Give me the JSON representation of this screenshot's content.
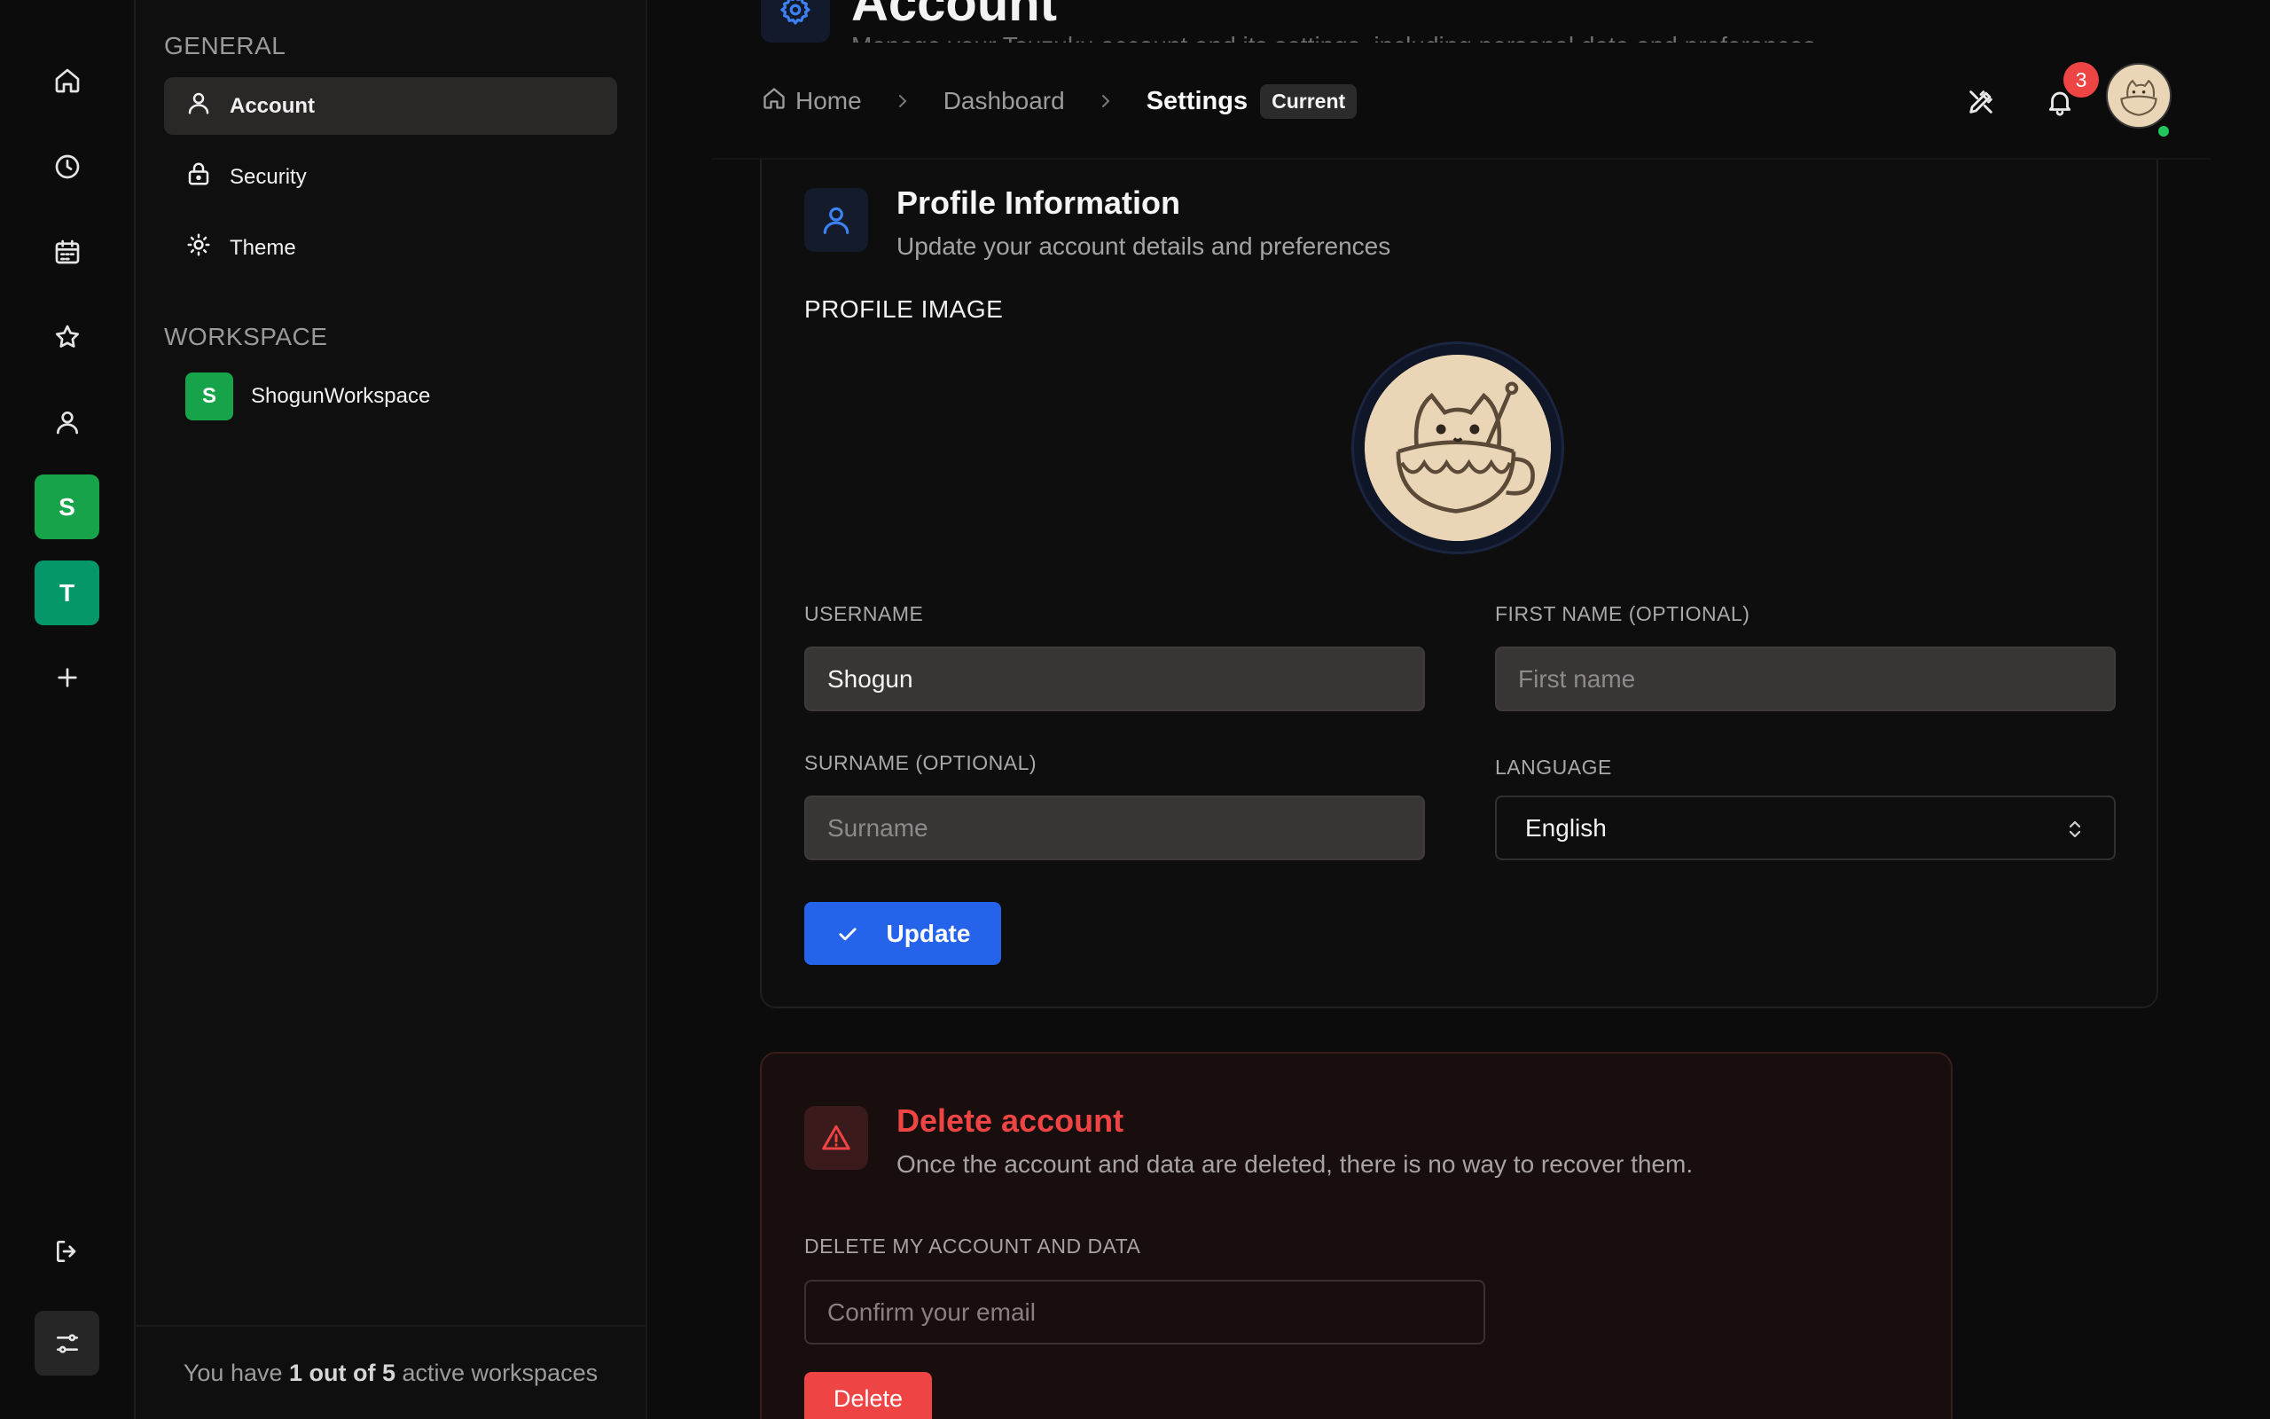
{
  "page": {
    "title": "Account",
    "subtitle": "Manage your Tsuzuku account and its settings, including personal data and preferences."
  },
  "rail": {
    "workspaces": [
      {
        "initial": "S",
        "color": "#16a34a"
      },
      {
        "initial": "T",
        "color": "#059669"
      }
    ]
  },
  "sidebar": {
    "general_label": "GENERAL",
    "items": [
      {
        "label": "Account",
        "icon": "user-icon",
        "active": true
      },
      {
        "label": "Security",
        "icon": "lock-icon",
        "active": false
      },
      {
        "label": "Theme",
        "icon": "sun-icon",
        "active": false
      }
    ],
    "workspace_label": "WORKSPACE",
    "workspace": {
      "initial": "S",
      "name": "ShogunWorkspace"
    },
    "footer": {
      "prefix": "You have ",
      "count": "1 out of 5",
      "suffix": " active workspaces"
    }
  },
  "breadcrumb": {
    "home": "Home",
    "dashboard": "Dashboard",
    "current": "Settings",
    "badge": "Current"
  },
  "header": {
    "notification_count": "3"
  },
  "profile": {
    "title": "Profile Information",
    "subtitle": "Update your account details and preferences",
    "image_label": "PROFILE IMAGE",
    "username_label": "USERNAME",
    "username_value": "Shogun",
    "firstname_label": "FIRST NAME (OPTIONAL)",
    "firstname_placeholder": "First name",
    "surname_label": "SURNAME (OPTIONAL)",
    "surname_placeholder": "Surname",
    "language_label": "LANGUAGE",
    "language_value": "English",
    "update_label": "Update"
  },
  "danger": {
    "title": "Delete account",
    "subtitle": "Once the account and data are deleted, there is no way to recover them.",
    "field_label": "DELETE MY ACCOUNT AND DATA",
    "placeholder": "Confirm your email",
    "button_label": "Delete"
  },
  "colors": {
    "accent": "#2563eb",
    "danger": "#ef4444",
    "online": "#22c55e"
  }
}
